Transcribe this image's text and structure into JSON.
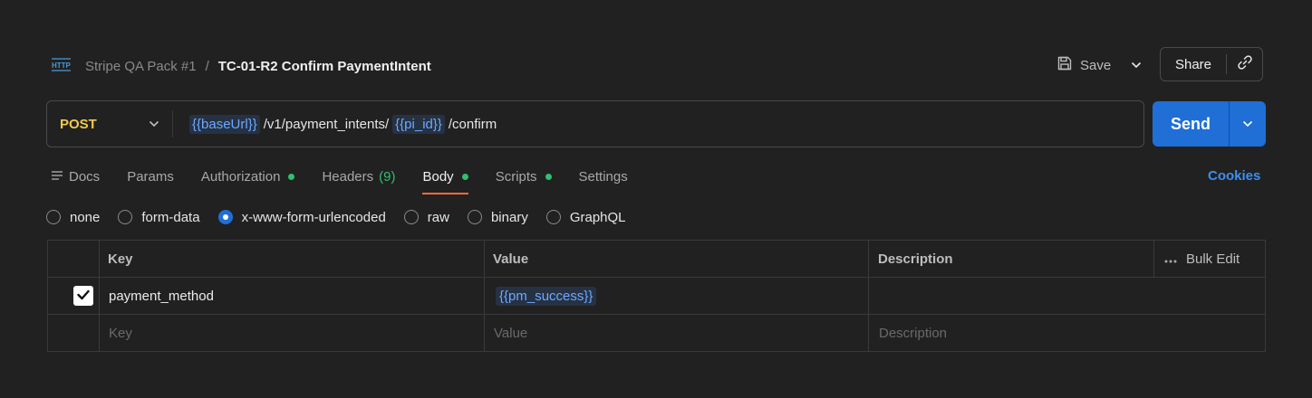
{
  "breadcrumb": {
    "collection": "Stripe QA Pack #1",
    "separator": "/",
    "request_name": "TC-01-R2 Confirm PaymentIntent"
  },
  "icons": {
    "request_type": "http-icon",
    "save": "floppy-disk-icon",
    "dropdown": "chevron-down-icon",
    "link": "link-icon",
    "docs": "docs-lines-icon",
    "more": "ellipsis-icon",
    "checkmark": "checkmark-icon"
  },
  "toolbar": {
    "save_label": "Save",
    "share_label": "Share"
  },
  "request": {
    "method": "POST",
    "url_parts": [
      {
        "text": "{{baseUrl}}",
        "variable": true
      },
      {
        "text": "/v1/payment_intents/",
        "variable": false
      },
      {
        "text": "{{pi_id}}",
        "variable": true
      },
      {
        "text": "/confirm",
        "variable": false
      }
    ]
  },
  "send_label": "Send",
  "tabs": [
    {
      "label": "Docs",
      "active": false
    },
    {
      "label": "Params",
      "active": false
    },
    {
      "label": "Authorization",
      "active": false,
      "dot": true
    },
    {
      "label": "Headers",
      "count": "(9)",
      "active": false
    },
    {
      "label": "Body",
      "active": true,
      "dot": true
    },
    {
      "label": "Scripts",
      "active": false,
      "dot": true
    },
    {
      "label": "Settings",
      "active": false
    }
  ],
  "cookies_label": "Cookies",
  "body_modes": [
    {
      "label": "none",
      "selected": false
    },
    {
      "label": "form-data",
      "selected": false
    },
    {
      "label": "x-www-form-urlencoded",
      "selected": true
    },
    {
      "label": "raw",
      "selected": false
    },
    {
      "label": "binary",
      "selected": false
    },
    {
      "label": "GraphQL",
      "selected": false
    }
  ],
  "table": {
    "headers": {
      "key": "Key",
      "value": "Value",
      "description": "Description",
      "bulk_edit": "Bulk Edit"
    },
    "rows": [
      {
        "checked": true,
        "key": "payment_method",
        "value": "{{pm_success}}",
        "description": ""
      }
    ],
    "placeholders": {
      "key": "Key",
      "value": "Value",
      "description": "Description"
    }
  },
  "colors": {
    "background": "#212121",
    "method_post": "#f2c94c",
    "accent_blue": "#1f6fd6",
    "active_tab_underline": "#ff6c37",
    "status_dot": "#2fbf71",
    "variable_text": "#6ea8fe",
    "cookies_link": "#3d8ff0"
  }
}
